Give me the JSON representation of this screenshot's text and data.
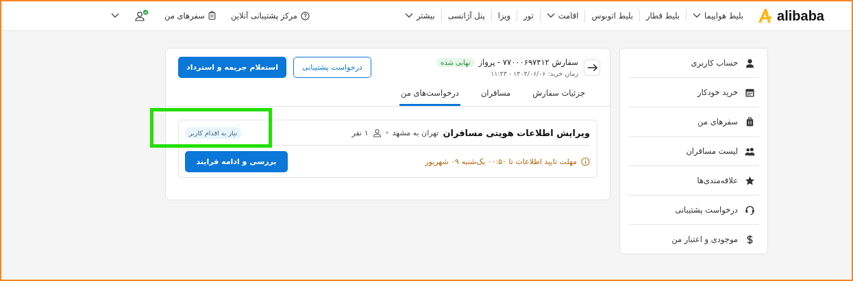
{
  "header": {
    "logo": "alibaba",
    "nav": [
      {
        "label": "بلیط هواپیما",
        "dropdown": true
      },
      {
        "label": "بلیط قطار",
        "dropdown": false
      },
      {
        "label": "بلیط اتوبوس",
        "dropdown": false
      },
      {
        "label": "اقامت",
        "dropdown": true
      },
      {
        "label": "تور",
        "dropdown": false
      },
      {
        "label": "ویزا",
        "dropdown": false
      },
      {
        "label": "پنل آژانسی",
        "dropdown": false
      },
      {
        "label": "بیشتر",
        "dropdown": true
      }
    ],
    "support": "مرکز پشتیبانی آنلاین",
    "trips": "سفرهای من",
    "user_verified": true
  },
  "sidebar": {
    "items": [
      {
        "label": "حساب کاربری",
        "kind": "user"
      },
      {
        "label": "خرید خودکار",
        "kind": "calendar"
      },
      {
        "label": "سفرهای من",
        "kind": "suitcase"
      },
      {
        "label": "لیست مسافران",
        "kind": "users"
      },
      {
        "label": "علاقه‌مندی‌ها",
        "kind": "star"
      },
      {
        "label": "درخواست پشتیبانی",
        "kind": "headset"
      },
      {
        "label": "موجودی و اعتبار من",
        "kind": "dollar"
      }
    ]
  },
  "order": {
    "title": "سفارش ۷۷۰۰۰۶۹۷۴۱۲ - پرواز",
    "status": "نهایی شده",
    "purchase_time": "زمان خرید: ۱۴۰۴/۰۶/۰۶ - ۱۱:۲۳",
    "buttons": [
      {
        "label": "درخواست پشتیبانی",
        "kind": "outline"
      },
      {
        "label": "استعلام جریمه و استرداد",
        "kind": "primary"
      }
    ],
    "tabs": [
      {
        "label": "جزئیات سفارش",
        "selected": false
      },
      {
        "label": "مسافران",
        "selected": false
      },
      {
        "label": "درخواست‌های من",
        "selected": true
      }
    ],
    "request": {
      "title": "ویرایش اطلاعات هویتی مسافران",
      "route": "تهران به مشهد",
      "passengers": "۱ نفر",
      "tag": "نیاز به اقدام کاربر",
      "deadline": "مهلت تایید اطلاعات تا ۰۰:۵۰ یک‌شنبه ۰۹ شهریور",
      "action": "بررسی و ادامه فرایند"
    }
  }
}
